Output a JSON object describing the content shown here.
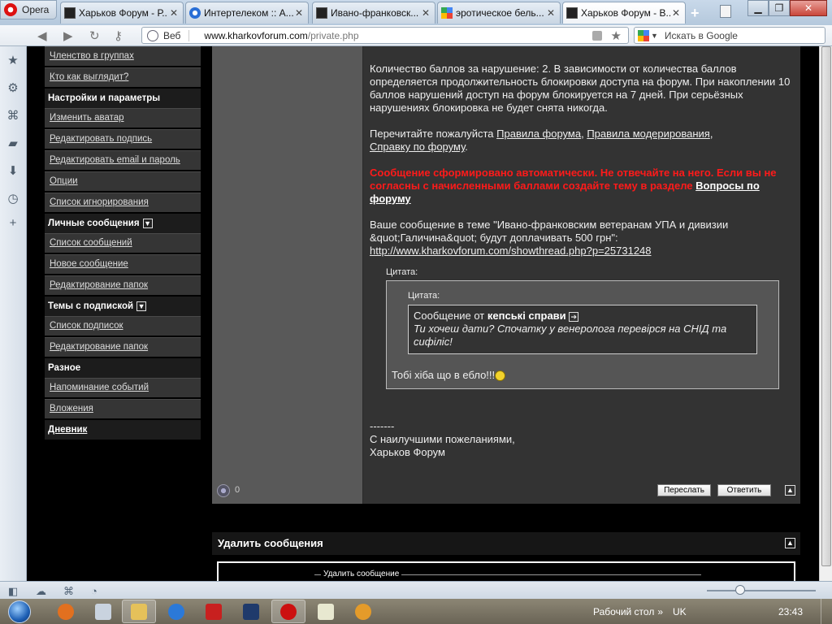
{
  "browser": {
    "menu_label": "Opera",
    "tabs": [
      {
        "title": "Харьков Форум - Р...",
        "icon": "forum-favicon"
      },
      {
        "title": "Интертелеком :: А...",
        "icon": "ie-favicon"
      },
      {
        "title": "Ивано-франковск...",
        "icon": "forum-favicon"
      },
      {
        "title": "эротическое бель...",
        "icon": "google-favicon"
      },
      {
        "title": "Харьков Форум - В...",
        "icon": "forum-favicon"
      }
    ],
    "close_glyph": "✕",
    "new_tab_glyph": "+",
    "address": {
      "label": "Веб",
      "host": "www.kharkovforum.com",
      "path": "/private.php"
    },
    "search_placeholder": "Искать в Google"
  },
  "nav": {
    "items": [
      {
        "type": "link",
        "label": "Членство в группах"
      },
      {
        "type": "link",
        "label": "Кто как выглядит?"
      },
      {
        "type": "head",
        "label": "Настройки и параметры"
      },
      {
        "type": "link",
        "label": "Изменить аватар"
      },
      {
        "type": "link",
        "label": "Редактировать подпись"
      },
      {
        "type": "link",
        "label": "Редактировать email и пароль"
      },
      {
        "type": "link",
        "label": "Опции"
      },
      {
        "type": "link",
        "label": "Список игнорирования"
      },
      {
        "type": "head",
        "label": "Личные сообщения",
        "collapse": true
      },
      {
        "type": "link",
        "label": "Список сообщений"
      },
      {
        "type": "link",
        "label": "Новое сообщение"
      },
      {
        "type": "link",
        "label": "Редактирование папок"
      },
      {
        "type": "head",
        "label": "Темы с подпиской",
        "collapse": true
      },
      {
        "type": "link",
        "label": "Список подписок"
      },
      {
        "type": "link",
        "label": "Редактирование папок"
      },
      {
        "type": "head",
        "label": "Разное"
      },
      {
        "type": "link",
        "label": "Напоминание событий"
      },
      {
        "type": "link",
        "label": "Вложения"
      },
      {
        "type": "head",
        "label": "Дневник",
        "underline": true
      }
    ]
  },
  "message": {
    "para1": "Количество баллов за нарушение: 2. В зависимости от количества баллов определяется продолжительность блокировки доступа на форум. При накоплении 10 баллов нарушений доступ на форум блокируется на 7 дней. При серьёзных нарушениях блокировка не будет снята никогда.",
    "reread_prefix": "Перечитайте пожалуйста ",
    "link_rules": "Правила форума",
    "sep1": ", ",
    "link_moderation": "Правила модерирования",
    "sep2": ",",
    "link_help": "Справку по форуму",
    "end_dot": ".",
    "warning_text": "Сообщение сформировано автоматически. Не отвечайте на него. Если вы не согласны с начисленными баллами создайте тему в разделе ",
    "warning_link": "Вопросы по форуму",
    "topic_line": "Ваше сообщение в теме \"Ивано-франковским ветеранам УПА и дивизии &quot;Галичина&quot; будут доплачивать 500 грн\":",
    "topic_url": "http://www.kharkovforum.com/showthread.php?p=25731248",
    "quote_label": "Цитата:",
    "inner_quote_label": "Цитата:",
    "inner_from_prefix": "Сообщение от ",
    "inner_author": "кепські справи",
    "inner_text": "Ти хочеш дати? Спочатку у венеролога перевірся на СНІД та сифіліс!",
    "reply_text": "Тобі хіба що в ебло!!!",
    "sig_dashes": "-------",
    "sig_line1": "С наилучшими пожеланиями,",
    "sig_line2": "Харьков Форум"
  },
  "post_buttons": {
    "forward": "Переслать",
    "reply": "Ответить",
    "attach_glyph": "0"
  },
  "delete_section": {
    "title": "Удалить сообщения",
    "legend": "Удалить сообщение"
  },
  "taskbar": {
    "desktop_label": "Рабочий стол",
    "lang": "UK",
    "clock": "23:43",
    "apps": [
      {
        "name": "firefox",
        "color": "#e2701f"
      },
      {
        "name": "calculator",
        "color": "#c9d3df"
      },
      {
        "name": "explorer",
        "color": "#e5c15a"
      },
      {
        "name": "internet-explorer",
        "color": "#2b79d8"
      },
      {
        "name": "filezilla",
        "color": "#c8201f"
      },
      {
        "name": "photoshop",
        "color": "#1f3a6b"
      },
      {
        "name": "opera",
        "color": "#cc1010"
      },
      {
        "name": "notepad",
        "color": "#e8e8d0"
      },
      {
        "name": "chrome",
        "color": "#e49b2a"
      }
    ]
  }
}
